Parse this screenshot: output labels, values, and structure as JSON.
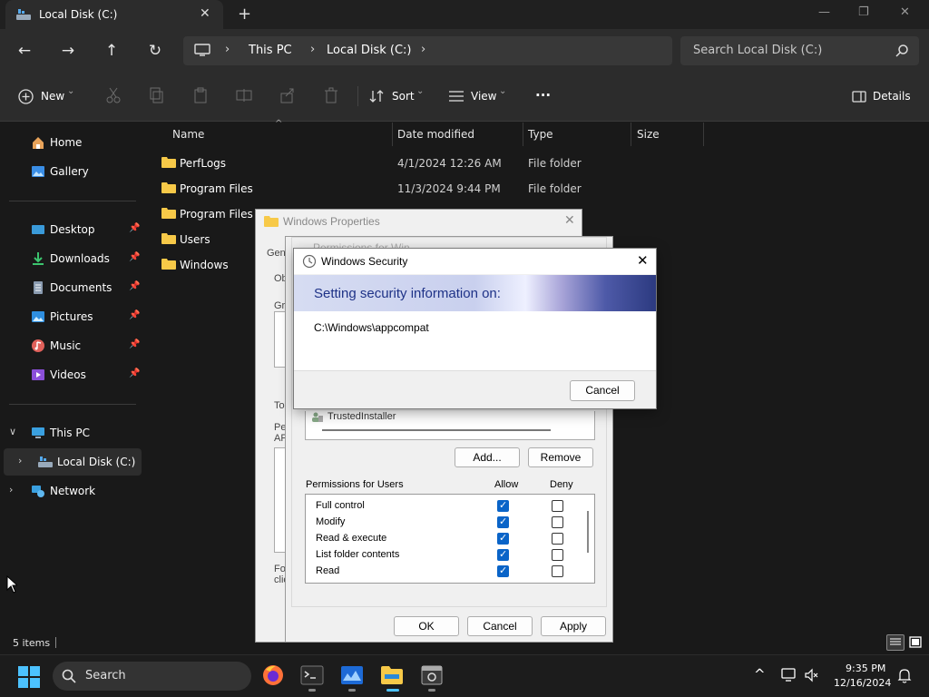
{
  "window": {
    "tab_title": "Local Disk (C:)",
    "tab_close": "✕",
    "new_tab": "+",
    "minimize": "—",
    "maximize": "❐",
    "close": "✕"
  },
  "nav": {
    "back": "←",
    "forward": "→",
    "up": "↑",
    "refresh": "↻",
    "breadcrumb": [
      "This PC",
      "Local Disk (C:)"
    ],
    "chevron": "›",
    "search_placeholder": "Search Local Disk (C:)"
  },
  "command_bar": {
    "new_label": "New",
    "sort_label": "Sort",
    "view_label": "View",
    "more": "···",
    "details_label": "Details",
    "caret": "⌄"
  },
  "sidebar": {
    "items": [
      {
        "label": "Home",
        "icon": "home-icon"
      },
      {
        "label": "Gallery",
        "icon": "gallery-icon"
      },
      {
        "label": "Desktop",
        "icon": "desktop-icon",
        "pinned": true
      },
      {
        "label": "Downloads",
        "icon": "download-icon",
        "pinned": true
      },
      {
        "label": "Documents",
        "icon": "documents-icon",
        "pinned": true
      },
      {
        "label": "Pictures",
        "icon": "pictures-icon",
        "pinned": true
      },
      {
        "label": "Music",
        "icon": "music-icon",
        "pinned": true
      },
      {
        "label": "Videos",
        "icon": "videos-icon",
        "pinned": true
      },
      {
        "label": "This PC",
        "icon": "pc-icon"
      },
      {
        "label": "Local Disk (C:)",
        "icon": "drive-icon"
      },
      {
        "label": "Network",
        "icon": "network-icon"
      }
    ],
    "pin_glyph": "📌",
    "expand_open": "∨",
    "expand_closed": "›"
  },
  "file_list": {
    "columns": [
      "Name",
      "Date modified",
      "Type",
      "Size"
    ],
    "sort_arrow": "^",
    "rows": [
      {
        "name": "PerfLogs",
        "date": "4/1/2024 12:26 AM",
        "type": "File folder"
      },
      {
        "name": "Program Files",
        "date": "11/3/2024 9:44 PM",
        "type": "File folder"
      },
      {
        "name": "Program Files (x",
        "date": "",
        "type": ""
      },
      {
        "name": "Users",
        "date": "",
        "type": ""
      },
      {
        "name": "Windows",
        "date": "",
        "type": ""
      }
    ]
  },
  "status": {
    "items_count": "5 items"
  },
  "properties_dialog": {
    "title": "Windows Properties",
    "tab_fragment": "Gen",
    "fragments": [
      "Ob",
      "Gr",
      "To",
      "Pe",
      "AP",
      "Fo",
      "clic"
    ]
  },
  "permissions_dialog": {
    "title_fragment": "Permissions for Win",
    "principal": "TrustedInstaller",
    "add_label": "Add...",
    "remove_label": "Remove",
    "permissions_header": "Permissions for Users",
    "allow_header": "Allow",
    "deny_header": "Deny",
    "permissions": [
      {
        "name": "Full control",
        "allow": true,
        "deny": false
      },
      {
        "name": "Modify",
        "allow": true,
        "deny": false
      },
      {
        "name": "Read & execute",
        "allow": true,
        "deny": false
      },
      {
        "name": "List folder contents",
        "allow": true,
        "deny": false
      },
      {
        "name": "Read",
        "allow": true,
        "deny": false
      }
    ],
    "ok_label": "OK",
    "cancel_label": "Cancel",
    "apply_label": "Apply"
  },
  "security_dialog": {
    "title": "Windows Security",
    "heading": "Setting security information on:",
    "path": "C:\\Windows\\appcompat",
    "cancel_label": "Cancel",
    "close": "✕"
  },
  "taskbar": {
    "search_label": "Search",
    "time": "9:35 PM",
    "date": "12/16/2024",
    "tray_chevron": "^"
  },
  "colors": {
    "accent": "#0a64c8",
    "folder": "#f7c948"
  }
}
